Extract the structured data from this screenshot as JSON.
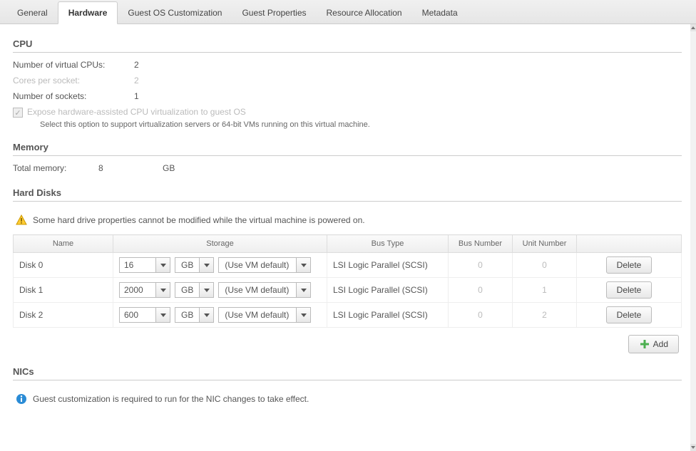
{
  "tabs": [
    {
      "label": "General"
    },
    {
      "label": "Hardware"
    },
    {
      "label": "Guest OS Customization"
    },
    {
      "label": "Guest Properties"
    },
    {
      "label": "Resource Allocation"
    },
    {
      "label": "Metadata"
    }
  ],
  "activeTabIndex": 1,
  "cpu": {
    "title": "CPU",
    "vcpus_label": "Number of virtual CPUs:",
    "vcpus_value": "2",
    "cores_label": "Cores per socket:",
    "cores_value": "2",
    "sockets_label": "Number of sockets:",
    "sockets_value": "1",
    "expose_label": "Expose hardware-assisted CPU virtualization to guest OS",
    "expose_desc": "Select this option to support virtualization servers or 64-bit VMs running on this virtual machine."
  },
  "memory": {
    "title": "Memory",
    "total_label": "Total memory:",
    "total_value": "8",
    "total_unit": "GB"
  },
  "hard_disks": {
    "title": "Hard Disks",
    "warning": "Some hard drive properties cannot be modified while the virtual machine is powered on.",
    "columns": {
      "name": "Name",
      "storage": "Storage",
      "bus_type": "Bus Type",
      "bus_number": "Bus Number",
      "unit_number": "Unit Number",
      "actions": ""
    },
    "rows": [
      {
        "name": "Disk 0",
        "size": "16",
        "unit": "GB",
        "policy": "(Use VM default)",
        "bus_type": "LSI Logic Parallel (SCSI)",
        "bus_number": "0",
        "unit_number": "0"
      },
      {
        "name": "Disk 1",
        "size": "2000",
        "unit": "GB",
        "policy": "(Use VM default)",
        "bus_type": "LSI Logic Parallel (SCSI)",
        "bus_number": "0",
        "unit_number": "1"
      },
      {
        "name": "Disk 2",
        "size": "600",
        "unit": "GB",
        "policy": "(Use VM default)",
        "bus_type": "LSI Logic Parallel (SCSI)",
        "bus_number": "0",
        "unit_number": "2"
      }
    ],
    "delete_label": "Delete",
    "add_label": "Add"
  },
  "nics": {
    "title": "NICs",
    "info": "Guest customization is required to run for the NIC changes to take effect."
  }
}
